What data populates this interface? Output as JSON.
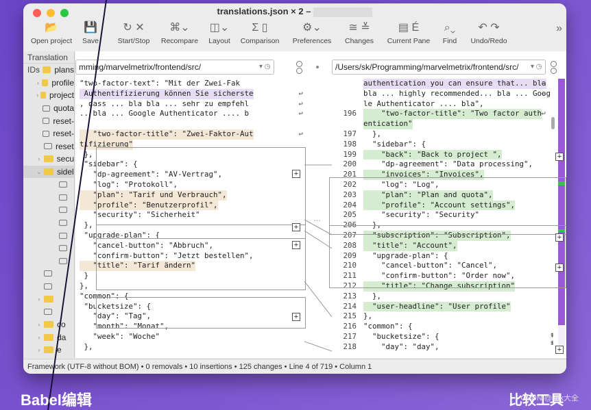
{
  "window": {
    "title": "translations.json × 2 –"
  },
  "toolbar": [
    {
      "label": "Open project",
      "icon": "folder-icon",
      "glyph": "📂"
    },
    {
      "label": "Save",
      "icon": "save-icon",
      "glyph": "💾"
    },
    {
      "label": "Start/Stop",
      "icon": "refresh-icon",
      "glyph": "↻  ✕"
    },
    {
      "label": "Recompare",
      "icon": "recompare-icon",
      "glyph": "⌘⌄"
    },
    {
      "label": "Layout",
      "icon": "layout-icon",
      "glyph": "◫⌄"
    },
    {
      "label": "Comparison",
      "icon": "sigma-icon",
      "glyph": "Σ ▯"
    },
    {
      "label": "Preferences",
      "icon": "gear-icon",
      "glyph": "⚙⌄"
    },
    {
      "label": "Changes",
      "icon": "changes-icon",
      "glyph": "≅ ≚"
    },
    {
      "label": "Current Pane",
      "icon": "pane-icon",
      "glyph": "▤ É"
    },
    {
      "label": "Find",
      "icon": "search-icon",
      "glyph": "⌕⌄"
    },
    {
      "label": "Undo/Redo",
      "icon": "undo-icon",
      "glyph": "↶ ↷"
    }
  ],
  "overflow_glyph": "»",
  "sidebar": {
    "header": "Translation IDs",
    "items": [
      {
        "label": "plans",
        "type": "folder",
        "chev": "›"
      },
      {
        "label": "profile",
        "type": "folder",
        "chev": "›"
      },
      {
        "label": "project",
        "type": "folder",
        "chev": "›"
      },
      {
        "label": "quota",
        "type": "comment",
        "chev": ""
      },
      {
        "label": "reset-",
        "type": "comment",
        "chev": ""
      },
      {
        "label": "reset-",
        "type": "comment",
        "chev": ""
      },
      {
        "label": "reset",
        "type": "comment",
        "chev": ""
      },
      {
        "label": "secu",
        "type": "folder",
        "chev": "›"
      },
      {
        "label": "sidel",
        "type": "folder",
        "chev": "⌄",
        "selected": true
      },
      {
        "label": "",
        "type": "comment",
        "chev": "",
        "indent": true
      },
      {
        "label": "",
        "type": "comment",
        "chev": "",
        "indent": true
      },
      {
        "label": "",
        "type": "comment",
        "chev": "",
        "indent": true
      },
      {
        "label": "",
        "type": "comment",
        "chev": "",
        "indent": true
      },
      {
        "label": "",
        "type": "comment",
        "chev": "",
        "indent": true
      },
      {
        "label": "",
        "type": "comment",
        "chev": "",
        "indent": true
      },
      {
        "label": "",
        "type": "comment",
        "chev": "",
        "indent": true
      },
      {
        "label": "",
        "type": "comment",
        "chev": ""
      },
      {
        "label": "",
        "type": "comment",
        "chev": ""
      },
      {
        "label": "",
        "type": "folder",
        "chev": "›"
      },
      {
        "label": "",
        "type": "comment",
        "chev": ""
      },
      {
        "label": "co",
        "type": "folder",
        "chev": "›"
      },
      {
        "label": "da",
        "type": "folder",
        "chev": "›"
      },
      {
        "label": "e",
        "type": "folder",
        "chev": "›"
      }
    ]
  },
  "left_path": "mming/marvelmetrix/frontend/src/",
  "right_path": "/Users/sk/Programming/marvelmetrix/frontend/src/",
  "left_lines": [
    {
      "t": "\"two-factor-text\": \"Mit der Zwei-Fak",
      "c": "",
      "x": 0,
      "cont": false
    },
    {
      "t": " Authentifizierung können Sie sicherste",
      "c": "hl-purple",
      "x": 0,
      "cont": true
    },
    {
      "t": ", dass ... bla bla ... sehr zu empfehl",
      "c": "",
      "x": 0,
      "cont": true
    },
    {
      "t": ".. bla ... Google Authenticator .... b",
      "c": "",
      "x": 0,
      "cont": true
    },
    {
      "t": "",
      "c": "",
      "x": 0,
      "cont": false
    },
    {
      "t": "   \"two-factor-title\": \"Zwei-Faktor-Aut",
      "c": "hl-tan",
      "x": 0,
      "cont": true
    },
    {
      "t": "tifizierung\"",
      "c": "hl-tan",
      "x": 0,
      "cont": false
    },
    {
      "t": " },",
      "c": "",
      "x": 0,
      "cont": false
    },
    {
      "t": " \"sidebar\": {",
      "c": "",
      "x": 0,
      "cont": false
    },
    {
      "t": "   \"dp-agreement\": \"AV-Vertrag\",",
      "c": "",
      "x": 0,
      "cont": false
    },
    {
      "t": "   \"log\": \"Protokoll\",",
      "c": "",
      "x": 0,
      "cont": false
    },
    {
      "t": "   \"plan\": \"Tarif und Verbrauch\",",
      "c": "hl-tan",
      "x": 0,
      "cont": false
    },
    {
      "t": "   \"profile\": \"Benutzerprofil\",",
      "c": "hl-tan",
      "x": 0,
      "cont": false
    },
    {
      "t": "   \"security\": \"Sicherheit\"",
      "c": "",
      "x": 0,
      "cont": false
    },
    {
      "t": " },",
      "c": "",
      "x": 0,
      "cont": false
    },
    {
      "t": " \"upgrade-plan\": {",
      "c": "",
      "x": 0,
      "cont": false
    },
    {
      "t": "   \"cancel-button\": \"Abbruch\",",
      "c": "",
      "x": 0,
      "cont": false
    },
    {
      "t": "   \"confirm-button\": \"Jetzt bestellen\",",
      "c": "",
      "x": 0,
      "cont": false
    },
    {
      "t": "   \"title\": \"Tarif ändern\"",
      "c": "hl-tan",
      "x": 0,
      "cont": false
    },
    {
      "t": " }",
      "c": "",
      "x": 0,
      "cont": false
    },
    {
      "t": "},",
      "c": "",
      "x": 0,
      "cont": false
    },
    {
      "t": "\"common\": {",
      "c": "",
      "x": 0,
      "cont": false
    },
    {
      "t": " \"bucketsize\": {",
      "c": "",
      "x": 0,
      "cont": false
    },
    {
      "t": "   \"day\": \"Tag\",",
      "c": "",
      "x": 0,
      "cont": false
    },
    {
      "t": "   \"month\": \"Monat\",",
      "c": "",
      "x": 0,
      "cont": false
    },
    {
      "t": "   \"week\": \"Woche\"",
      "c": "",
      "x": 0,
      "cont": false
    },
    {
      "t": " },",
      "c": "",
      "x": 0,
      "cont": false
    }
  ],
  "right_lines": [
    {
      "n": "",
      "t": "authentication you can ensure that... bla",
      "c": "hl-purple",
      "cont": true
    },
    {
      "n": "",
      "t": "bla ... highly recommended... bla ... Goog",
      "c": "",
      "cont": true
    },
    {
      "n": "",
      "t": "le Authenticator .... bla\",",
      "c": "",
      "cont": false
    },
    {
      "n": "196",
      "t": "    \"two-factor-title\": \"Two factor auth",
      "c": "hl-green",
      "cont": true
    },
    {
      "n": "",
      "t": "entication\"",
      "c": "hl-green",
      "cont": false
    },
    {
      "n": "197",
      "t": "  },",
      "c": "",
      "cont": false
    },
    {
      "n": "198",
      "t": "  \"sidebar\": {",
      "c": "",
      "cont": false
    },
    {
      "n": "199",
      "t": "    \"back\": \"Back to project \",",
      "c": "hl-green",
      "cont": false
    },
    {
      "n": "200",
      "t": "    \"dp-agreement\": \"Data processing\",",
      "c": "",
      "cont": false
    },
    {
      "n": "201",
      "t": "    \"invoices\": \"Invoices\",",
      "c": "hl-green",
      "cont": false
    },
    {
      "n": "202",
      "t": "    \"log\": \"Log\",",
      "c": "",
      "cont": false
    },
    {
      "n": "203",
      "t": "    \"plan\": \"Plan and quota\",",
      "c": "hl-green",
      "cont": false
    },
    {
      "n": "204",
      "t": "    \"profile\": \"Account settings\",",
      "c": "hl-green",
      "cont": false
    },
    {
      "n": "205",
      "t": "    \"security\": \"Security\"",
      "c": "",
      "cont": false
    },
    {
      "n": "206",
      "t": "  },",
      "c": "",
      "cont": false
    },
    {
      "n": "207",
      "t": "  \"subscription\": \"Subscription\",",
      "c": "hl-green",
      "cont": false
    },
    {
      "n": "208",
      "t": "  \"title\": \"Account\",",
      "c": "hl-green",
      "cont": false
    },
    {
      "n": "209",
      "t": "  \"upgrade-plan\": {",
      "c": "",
      "cont": false
    },
    {
      "n": "210",
      "t": "    \"cancel-button\": \"Cancel\",",
      "c": "",
      "cont": false
    },
    {
      "n": "211",
      "t": "    \"confirm-button\": \"Order now\",",
      "c": "",
      "cont": false
    },
    {
      "n": "212",
      "t": "    \"title\": \"Change subscription\"",
      "c": "hl-green",
      "cont": false
    },
    {
      "n": "213",
      "t": "  },",
      "c": "",
      "cont": false
    },
    {
      "n": "214",
      "t": "  \"user-headline\": \"User profile\"",
      "c": "hl-green",
      "cont": false
    },
    {
      "n": "215",
      "t": "},",
      "c": "",
      "cont": false
    },
    {
      "n": "216",
      "t": "\"common\": {",
      "c": "",
      "cont": false
    },
    {
      "n": "217",
      "t": "  \"bucketsize\": {",
      "c": "",
      "cont": false
    },
    {
      "n": "218",
      "t": "    \"day\": \"day\",",
      "c": "",
      "cont": false
    }
  ],
  "status": "Framework (UTF-8 without BOM) • 0 removals • 10 insertions • 125 changes • Line 4 of 719 • Column 1",
  "captions": {
    "left": "Babel编辑",
    "right": "比较工具",
    "watermark": "CSDN @sdk大全"
  },
  "colors": {
    "accent": "#9a58d9",
    "added": "#d5ecd1",
    "changed": "#f3e7d6",
    "word": "#ddd0f1"
  }
}
